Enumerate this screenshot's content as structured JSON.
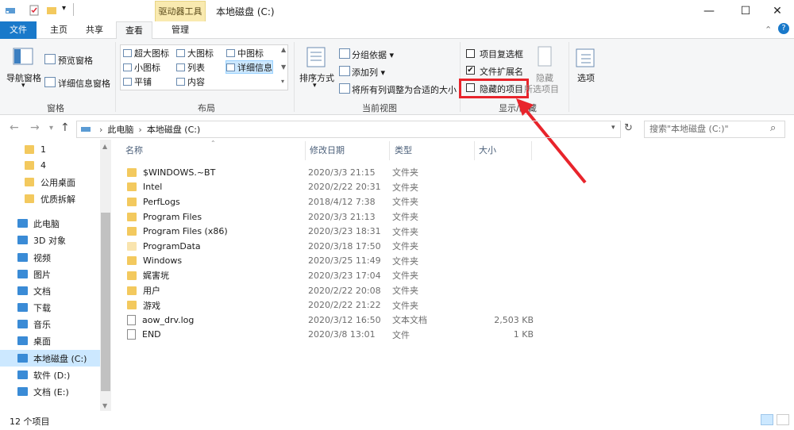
{
  "titlebar": {
    "context_tab": "驱动器工具",
    "title": "本地磁盘 (C:)",
    "minimize_icon": "minimize-icon",
    "maximize_icon": "maximize-icon",
    "close_icon": "close-icon"
  },
  "tabs": {
    "file": "文件",
    "home": "主页",
    "share": "共享",
    "view": "查看",
    "manage": "管理"
  },
  "ribbon": {
    "nav_pane": "导航窗格",
    "preview_pane": "预览窗格",
    "details_pane": "详细信息窗格",
    "panes_group": "窗格",
    "layout": {
      "extra_large": "超大图标",
      "large": "大图标",
      "medium": "中图标",
      "small": "小图标",
      "list": "列表",
      "details": "详细信息",
      "tiles": "平铺",
      "content": "内容"
    },
    "layout_group": "布局",
    "sort_by": "排序方式",
    "group_by": "分组依据",
    "add_columns": "添加列",
    "fit_columns": "将所有列调整为合适的大小",
    "current_view_group": "当前视图",
    "item_checkboxes": "项目复选框",
    "file_extensions": "文件扩展名",
    "hidden_items": "隐藏的项目",
    "hide_label1": "隐藏",
    "hide_label2": "所选项目",
    "show_hide_group": "显示/隐藏",
    "options": "选项",
    "checks": {
      "item_checkboxes": false,
      "file_extensions": true,
      "hidden_items": false
    }
  },
  "address": {
    "crumb1": "此电脑",
    "crumb2": "本地磁盘 (C:)",
    "search_placeholder": "搜索\"本地磁盘 (C:)\""
  },
  "nav": [
    {
      "label": "1",
      "icon": "folder-icon",
      "selected": false
    },
    {
      "label": "4",
      "icon": "folder-icon",
      "selected": false
    },
    {
      "label": "公用桌面",
      "icon": "folder-icon",
      "selected": false
    },
    {
      "label": "优质拆解",
      "icon": "folder-icon",
      "selected": false
    },
    {
      "label": "此电脑",
      "icon": "computer-icon",
      "selected": false
    },
    {
      "label": "3D 对象",
      "icon": "3d-objects-icon",
      "selected": false
    },
    {
      "label": "视频",
      "icon": "video-icon",
      "selected": false
    },
    {
      "label": "图片",
      "icon": "pictures-icon",
      "selected": false
    },
    {
      "label": "文档",
      "icon": "documents-icon",
      "selected": false
    },
    {
      "label": "下载",
      "icon": "download-icon",
      "selected": false
    },
    {
      "label": "音乐",
      "icon": "music-icon",
      "selected": false
    },
    {
      "label": "桌面",
      "icon": "desktop-icon",
      "selected": false
    },
    {
      "label": "本地磁盘 (C:)",
      "icon": "drive-icon",
      "selected": true
    },
    {
      "label": "软件 (D:)",
      "icon": "drive-icon",
      "selected": false
    },
    {
      "label": "文档 (E:)",
      "icon": "drive-icon",
      "selected": false
    }
  ],
  "columns": {
    "name": "名称",
    "date": "修改日期",
    "type": "类型",
    "size": "大小"
  },
  "files": [
    {
      "name": "$WINDOWS.~BT",
      "date": "2020/3/3 21:15",
      "type": "文件夹",
      "size": "",
      "kind": "folder"
    },
    {
      "name": "Intel",
      "date": "2020/2/22 20:31",
      "type": "文件夹",
      "size": "",
      "kind": "folder"
    },
    {
      "name": "PerfLogs",
      "date": "2018/4/12 7:38",
      "type": "文件夹",
      "size": "",
      "kind": "folder"
    },
    {
      "name": "Program Files",
      "date": "2020/3/3 21:13",
      "type": "文件夹",
      "size": "",
      "kind": "folder"
    },
    {
      "name": "Program Files (x86)",
      "date": "2020/3/23 18:31",
      "type": "文件夹",
      "size": "",
      "kind": "folder"
    },
    {
      "name": "ProgramData",
      "date": "2020/3/18 17:50",
      "type": "文件夹",
      "size": "",
      "kind": "folder-faded"
    },
    {
      "name": "Windows",
      "date": "2020/3/25 11:49",
      "type": "文件夹",
      "size": "",
      "kind": "folder"
    },
    {
      "name": "娓害垙",
      "date": "2020/3/23 17:04",
      "type": "文件夹",
      "size": "",
      "kind": "folder"
    },
    {
      "name": "用户",
      "date": "2020/2/22 20:08",
      "type": "文件夹",
      "size": "",
      "kind": "folder"
    },
    {
      "name": "游戏",
      "date": "2020/2/22 21:22",
      "type": "文件夹",
      "size": "",
      "kind": "folder"
    },
    {
      "name": "aow_drv.log",
      "date": "2020/3/12 16:50",
      "type": "文本文档",
      "size": "2,503 KB",
      "kind": "text"
    },
    {
      "name": "END",
      "date": "2020/3/8 13:01",
      "type": "文件",
      "size": "1 KB",
      "kind": "file"
    }
  ],
  "status": {
    "count": "12 个项目"
  },
  "colors": {
    "accent": "#1979ca",
    "highlight": "#e8242b",
    "folder": "#f3c95e",
    "selection": "#cce8ff"
  }
}
